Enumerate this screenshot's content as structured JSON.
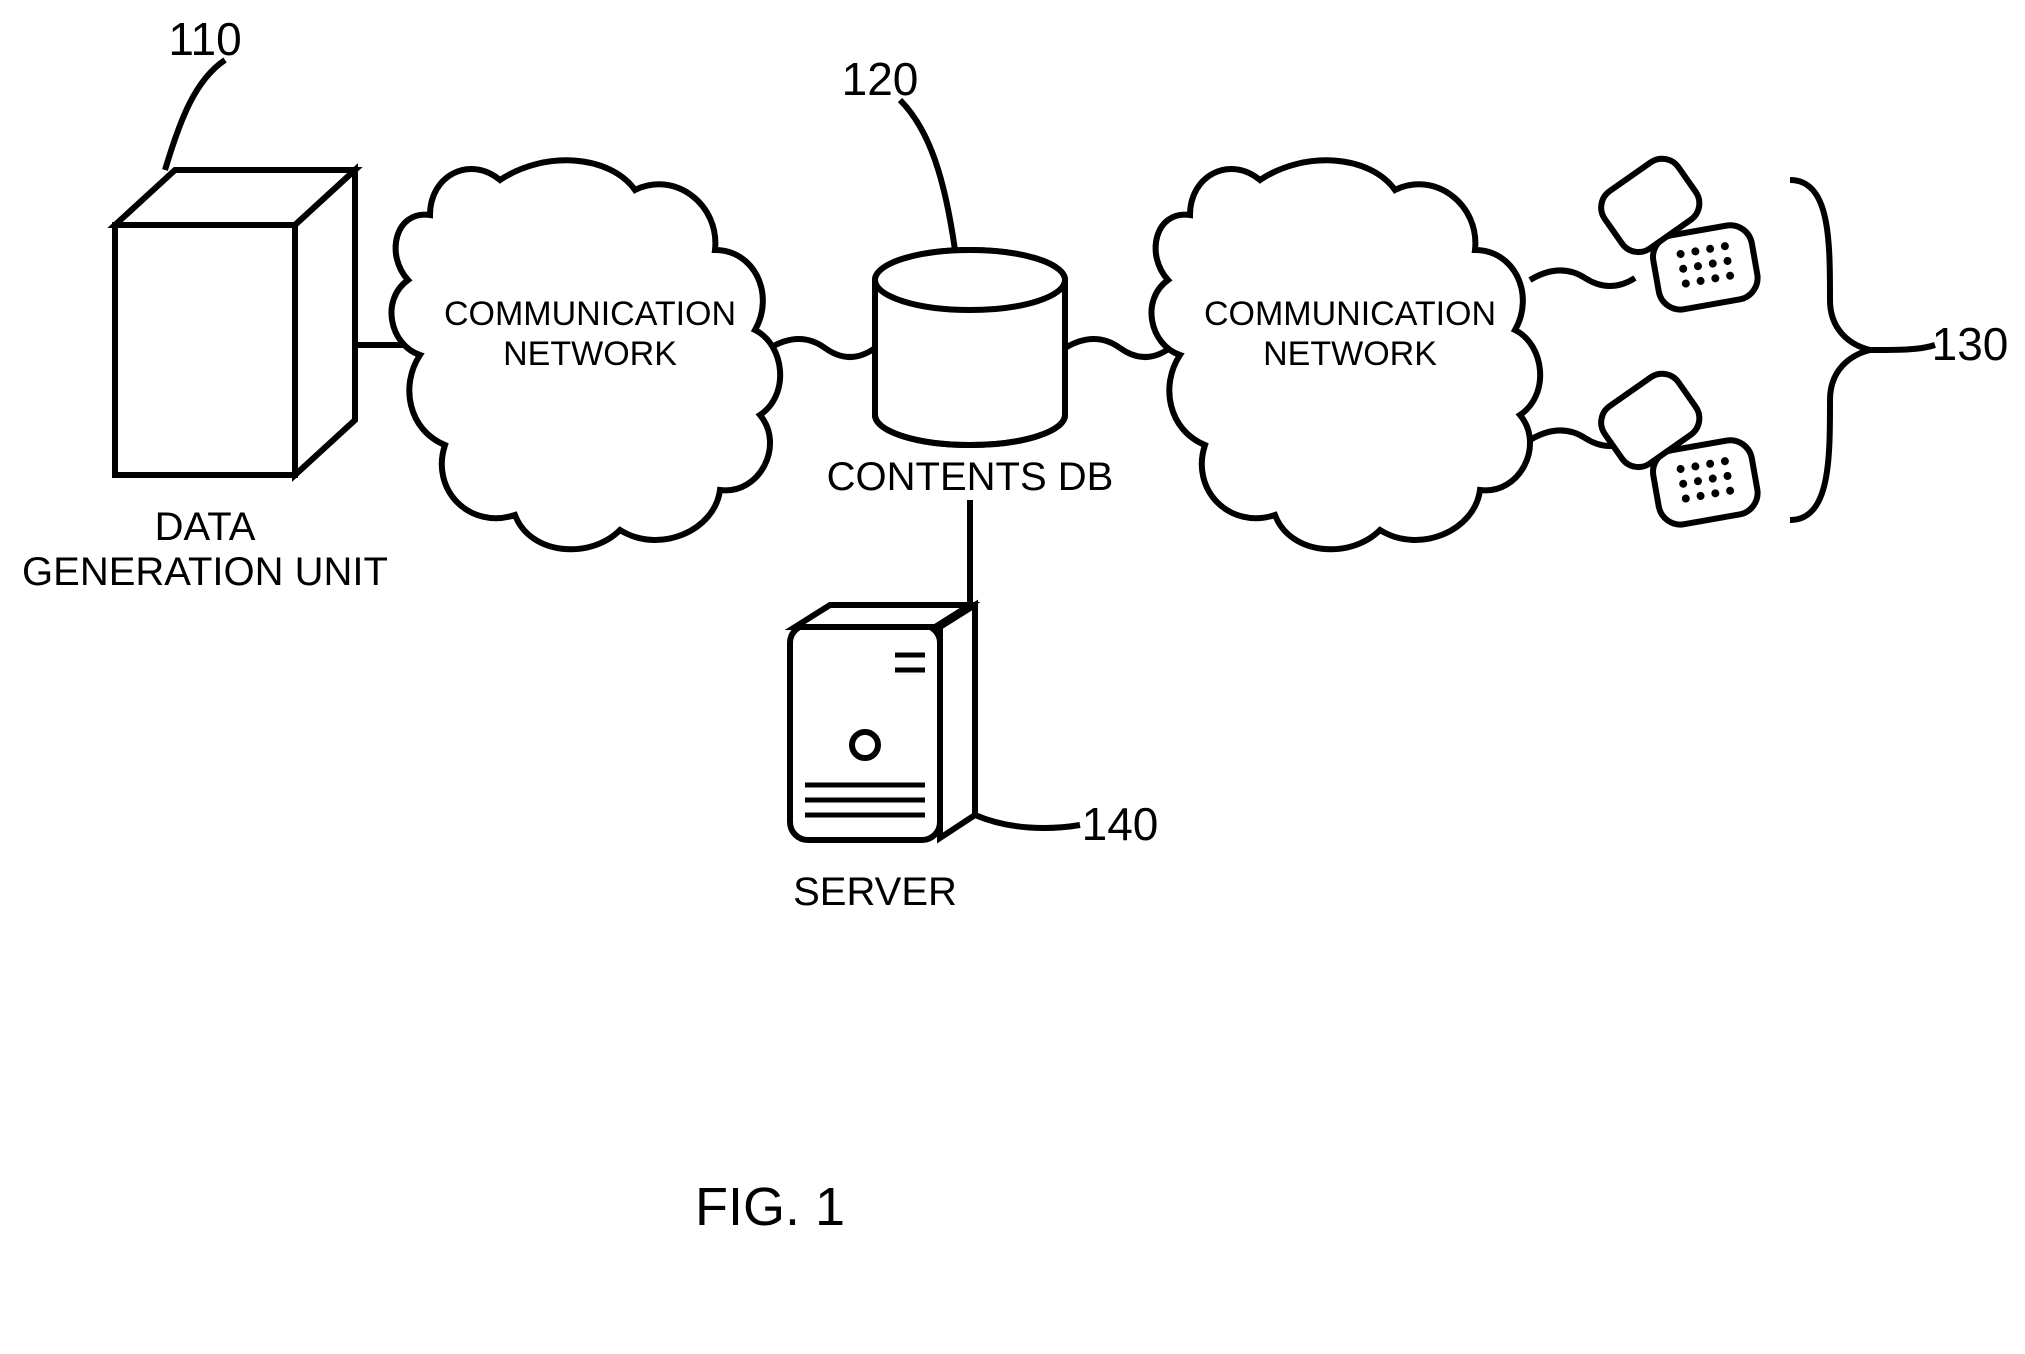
{
  "figure_caption": "FIG. 1",
  "nodes": {
    "data_gen": {
      "ref": "110",
      "label_line1": "DATA",
      "label_line2": "GENERATION UNIT"
    },
    "net1": {
      "line1": "COMMUNICATION",
      "line2": "NETWORK"
    },
    "db": {
      "ref": "120",
      "label": "CONTENTS DB"
    },
    "net2": {
      "line1": "COMMUNICATION",
      "line2": "NETWORK"
    },
    "phones": {
      "ref": "130"
    },
    "server": {
      "ref": "140",
      "label": "SERVER"
    }
  }
}
